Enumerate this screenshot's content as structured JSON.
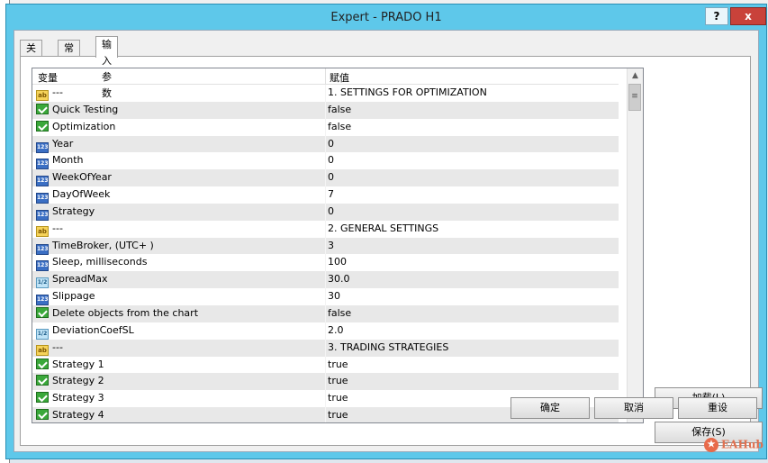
{
  "window": {
    "title": "Expert - PRADO H1",
    "help_label": "?",
    "close_label": "x"
  },
  "tabs": [
    {
      "label": "关于"
    },
    {
      "label": "常用"
    },
    {
      "label": "输入参数",
      "active": true
    }
  ],
  "grid": {
    "headers": {
      "variable": "变量",
      "value": "赋值"
    },
    "rows": [
      {
        "type": "ab",
        "name": "---",
        "value": "1. SETTINGS FOR OPTIMIZATION"
      },
      {
        "type": "bool",
        "name": "Quick Testing",
        "value": "false"
      },
      {
        "type": "bool",
        "name": "Optimization",
        "value": "false"
      },
      {
        "type": "int",
        "name": "Year",
        "value": "0"
      },
      {
        "type": "int",
        "name": "Month",
        "value": "0"
      },
      {
        "type": "int",
        "name": "WeekOfYear",
        "value": "0"
      },
      {
        "type": "int",
        "name": "DayOfWeek",
        "value": "7"
      },
      {
        "type": "int",
        "name": "Strategy",
        "value": "0"
      },
      {
        "type": "ab",
        "name": "---",
        "value": "2. GENERAL SETTINGS"
      },
      {
        "type": "int",
        "name": "TimeBroker, (UTC+ )",
        "value": "3"
      },
      {
        "type": "int",
        "name": "Sleep, milliseconds",
        "value": "100"
      },
      {
        "type": "dbl",
        "name": "SpreadMax",
        "value": "30.0"
      },
      {
        "type": "int",
        "name": "Slippage",
        "value": "30"
      },
      {
        "type": "bool",
        "name": "Delete objects from the chart",
        "value": "false"
      },
      {
        "type": "dbl",
        "name": "DeviationCoefSL",
        "value": "2.0"
      },
      {
        "type": "ab",
        "name": "---",
        "value": "3. TRADING STRATEGIES"
      },
      {
        "type": "bool",
        "name": "Strategy 1",
        "value": "true"
      },
      {
        "type": "bool",
        "name": "Strategy 2",
        "value": "true"
      },
      {
        "type": "bool",
        "name": "Strategy 3",
        "value": "true"
      },
      {
        "type": "bool",
        "name": "Strategy 4",
        "value": "true"
      }
    ]
  },
  "icons": {
    "ab": "ab",
    "int": "123",
    "dbl": "1/2"
  },
  "buttons": {
    "load": "加载(L)",
    "save": "保存(S)",
    "ok": "确定",
    "cancel": "取消",
    "reset": "重设"
  },
  "watermark": {
    "text": "EAHub"
  }
}
